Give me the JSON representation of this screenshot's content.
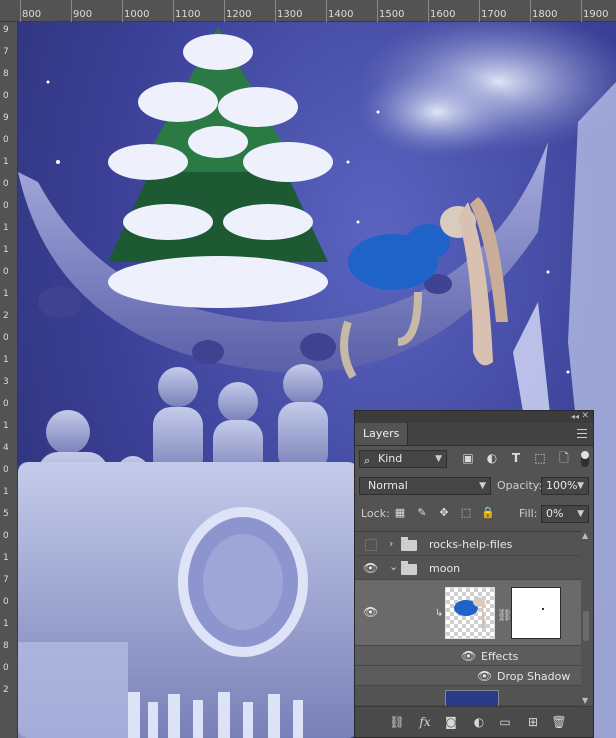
{
  "ruler": {
    "top_labels": [
      "800",
      "900",
      "1000",
      "1100",
      "1200",
      "1300",
      "1400",
      "1500",
      "1600",
      "1700",
      "1800",
      "1900"
    ],
    "left_labels": [
      "9",
      "7",
      "8",
      "0",
      "9",
      "0",
      "1",
      "0",
      "0",
      "1",
      "1",
      "0",
      "1",
      "2",
      "0",
      "1",
      "3",
      "0",
      "1",
      "4",
      "0",
      "1",
      "5",
      "0",
      "1",
      "7",
      "0",
      "1",
      "8",
      "0",
      "2"
    ]
  },
  "panel": {
    "tab_label": "Layers",
    "filter": {
      "kind_label": "Kind"
    },
    "blend_mode": "Normal",
    "opacity_label": "Opacity:",
    "opacity_value": "100%",
    "lock_label": "Lock:",
    "fill_label": "Fill:",
    "fill_value": "0%",
    "layers": [
      {
        "name": "rocks-help-files",
        "type": "group",
        "visible": false
      },
      {
        "name": "moon",
        "type": "group",
        "visible": true,
        "expanded": true
      },
      {
        "name": "",
        "type": "layer",
        "visible": true,
        "selected": true
      },
      {
        "name": "Effects",
        "type": "effects-header",
        "visible": true
      },
      {
        "name": "Drop Shadow",
        "type": "effect",
        "visible": true
      }
    ]
  },
  "colors": {
    "canvas_sky": "#3a3f95",
    "panel_bg": "#535353",
    "selected_row": "#6a6a6a",
    "coat_blue": "#1f63c8"
  }
}
